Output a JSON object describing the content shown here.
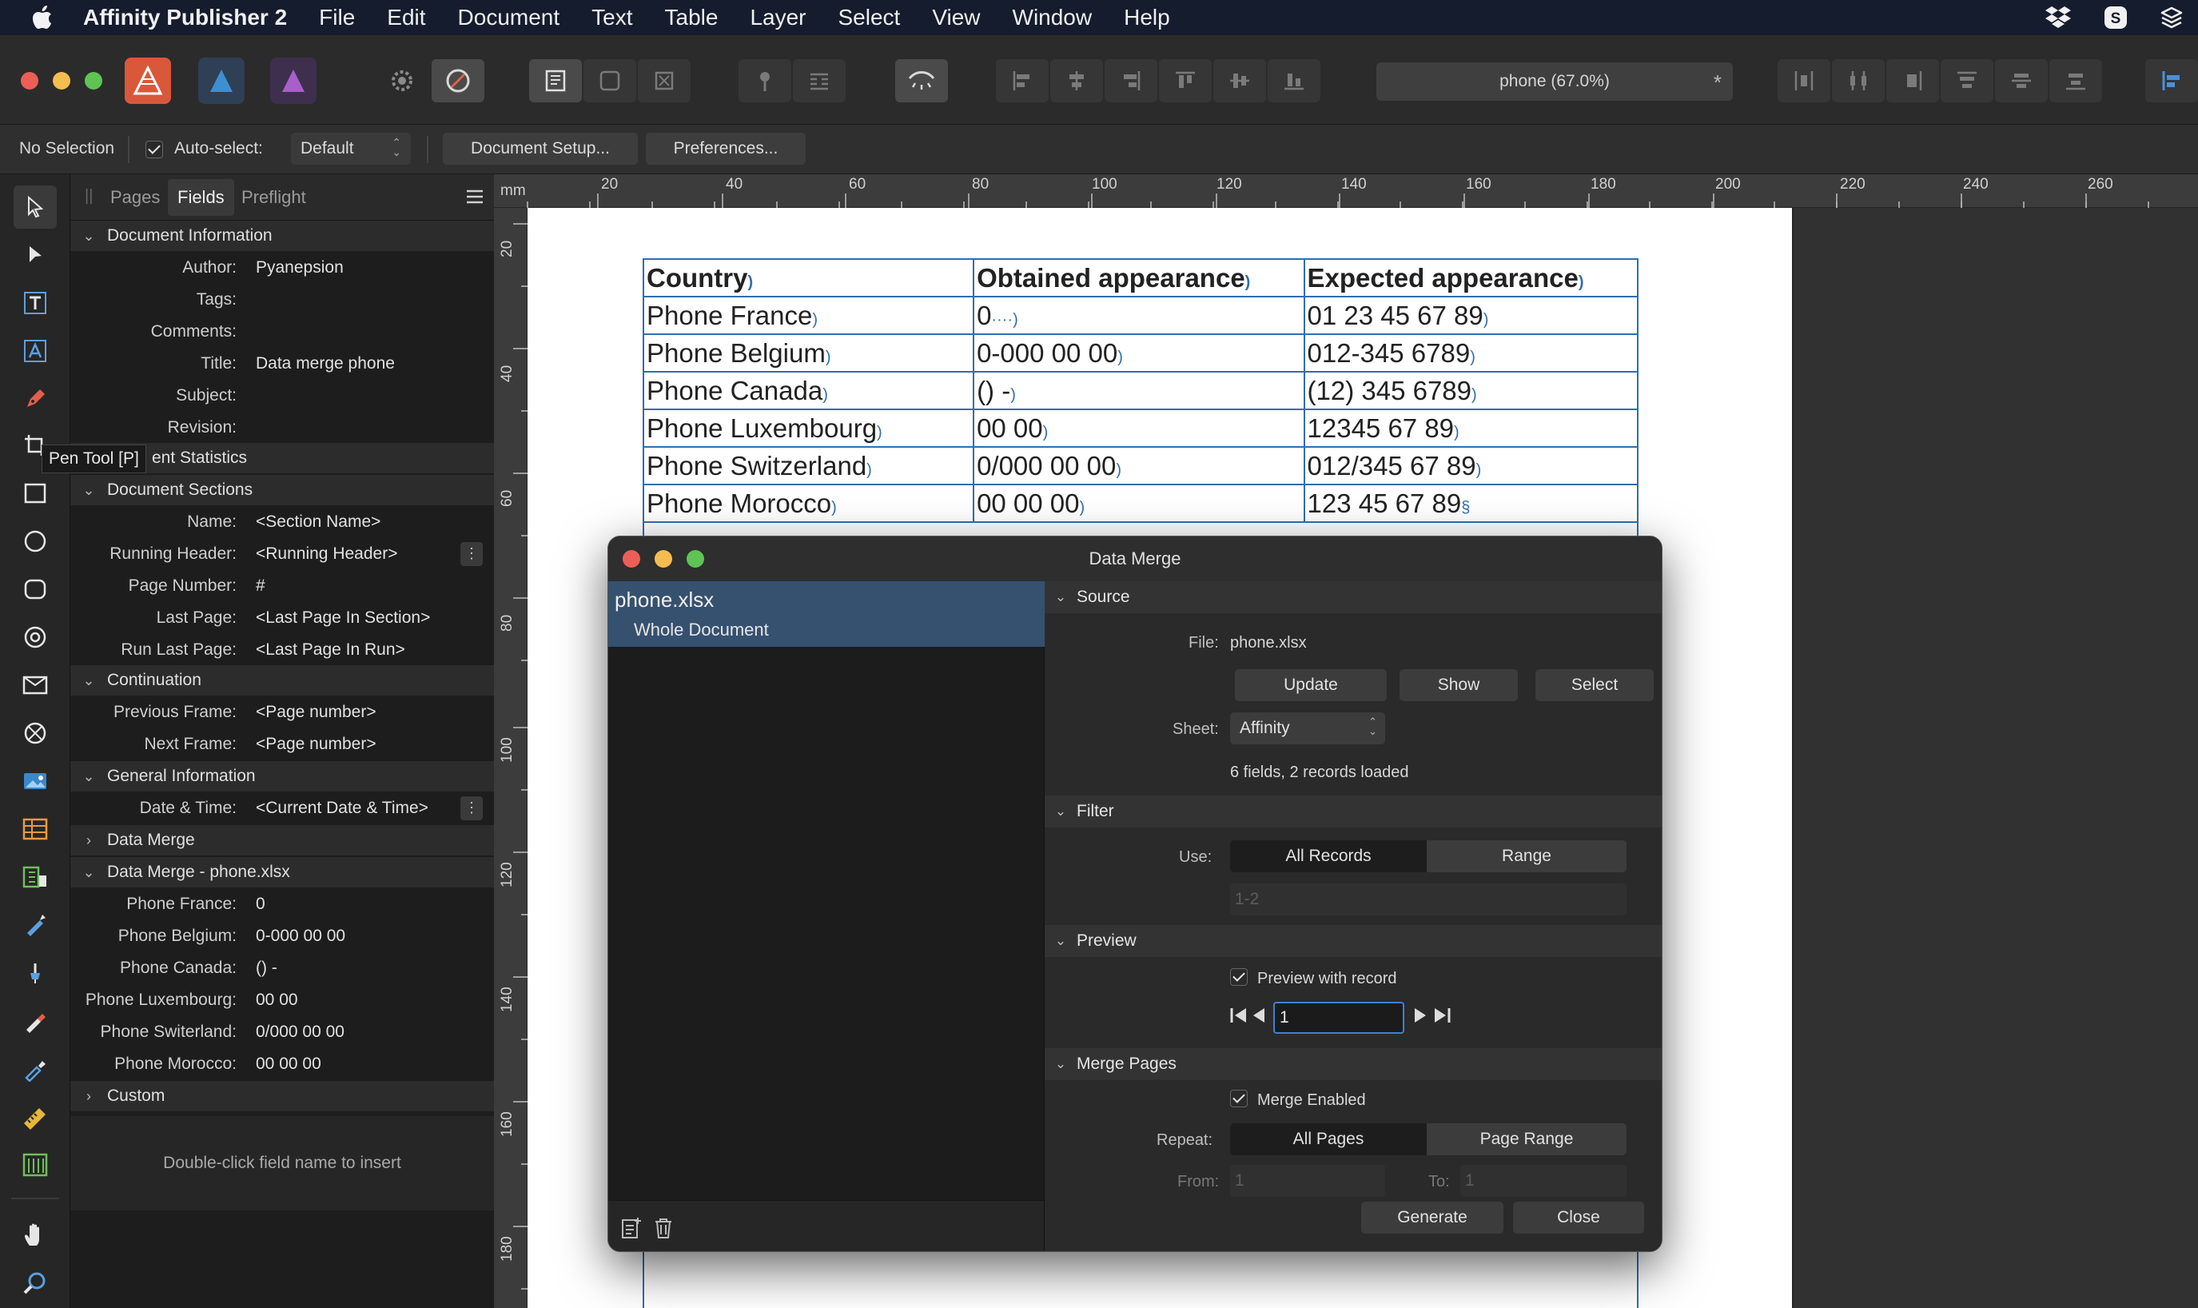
{
  "menubar": {
    "app_name": "Affinity Publisher 2",
    "items": [
      "File",
      "Edit",
      "Document",
      "Text",
      "Table",
      "Layer",
      "Select",
      "View",
      "Window",
      "Help"
    ]
  },
  "toolbar": {
    "zoom_label": "phone (67.0%)"
  },
  "context": {
    "selection": "No Selection",
    "autoselect_label": "Auto-select:",
    "autoselect_value": "Default",
    "doc_setup": "Document Setup...",
    "preferences": "Preferences..."
  },
  "tooltip": "Pen Tool [P]",
  "panel": {
    "tabs": [
      "Pages",
      "Fields",
      "Preflight"
    ],
    "doc_info": {
      "header": "Document Information",
      "rows": [
        {
          "k": "Author:",
          "v": "Pyanepsion"
        },
        {
          "k": "Tags:",
          "v": ""
        },
        {
          "k": "Comments:",
          "v": ""
        },
        {
          "k": "Title:",
          "v": "Data merge phone"
        },
        {
          "k": "Subject:",
          "v": ""
        },
        {
          "k": "Revision:",
          "v": ""
        }
      ]
    },
    "doc_stats_header": "ent Statistics",
    "sections": {
      "header": "Document Sections",
      "rows": [
        {
          "k": "Name:",
          "v": "<Section Name>"
        },
        {
          "k": "Running Header:",
          "v": "<Running Header>"
        },
        {
          "k": "Page Number:",
          "v": "#"
        },
        {
          "k": "Last Page:",
          "v": "<Last Page In Section>"
        },
        {
          "k": "Run Last Page:",
          "v": "<Last Page In Run>"
        }
      ]
    },
    "continuation": {
      "header": "Continuation",
      "rows": [
        {
          "k": "Previous Frame:",
          "v": "<Page number>"
        },
        {
          "k": "Next Frame:",
          "v": "<Page number>"
        }
      ]
    },
    "general": {
      "header": "General Information",
      "rows": [
        {
          "k": "Date & Time:",
          "v": "<Current Date & Time>"
        }
      ]
    },
    "data_merge_header": "Data Merge",
    "data_merge_file": {
      "header": "Data Merge - phone.xlsx",
      "rows": [
        {
          "k": "Phone France:",
          "v": "0"
        },
        {
          "k": "Phone Belgium:",
          "v": "0-000 00 00"
        },
        {
          "k": "Phone Canada:",
          "v": "() -"
        },
        {
          "k": "Phone Luxembourg:",
          "v": " 00 00"
        },
        {
          "k": "Phone Switerland:",
          "v": "0/000 00 00"
        },
        {
          "k": "Phone Morocco:",
          "v": " 00 00 00"
        }
      ]
    },
    "custom_header": "Custom",
    "hint": "Double-click field name to insert"
  },
  "ruler": {
    "unit": "mm",
    "h_ticks": [
      "20",
      "40",
      "60",
      "80",
      "100",
      "120",
      "140",
      "160",
      "180",
      "200",
      "220",
      "240",
      "260"
    ],
    "v_ticks": [
      "20",
      "40",
      "60",
      "80",
      "100",
      "120",
      "140",
      "160",
      "180"
    ]
  },
  "doc_table": {
    "headers": [
      "Country",
      "Obtained appearance",
      "Expected appearance"
    ],
    "rows": [
      [
        "Phone France",
        "0",
        "01 23 45 67 89"
      ],
      [
        "Phone Belgium",
        "0-000 00 00",
        "012-345 6789"
      ],
      [
        "Phone Canada",
        "() -",
        "(12) 345 6789"
      ],
      [
        "Phone Luxembourg",
        " 00 00",
        "12345 67 89"
      ],
      [
        "Phone Switzerland",
        "0/000 00 00",
        "012/345 67 89"
      ],
      [
        "Phone Morocco",
        " 00 00 00",
        "123 45 67 89"
      ]
    ]
  },
  "dialog": {
    "title": "Data Merge",
    "list_file": "phone.xlsx",
    "list_sub": "Whole Document",
    "source": {
      "header": "Source",
      "file_label": "File:",
      "file_value": "phone.xlsx",
      "update": "Update",
      "show": "Show",
      "select": "Select",
      "sheet_label": "Sheet:",
      "sheet_value": "Affinity",
      "status": "6 fields, 2 records loaded"
    },
    "filter": {
      "header": "Filter",
      "use_label": "Use:",
      "all_records": "All Records",
      "range": "Range",
      "range_placeholder": "1-2"
    },
    "preview": {
      "header": "Preview",
      "checkbox_label": "Preview with record",
      "record": "1"
    },
    "merge": {
      "header": "Merge Pages",
      "checkbox_label": "Merge Enabled",
      "repeat_label": "Repeat:",
      "all_pages": "All Pages",
      "page_range": "Page Range",
      "from_label": "From:",
      "from_value": "1",
      "to_label": "To:",
      "to_value": "1",
      "generate": "Generate",
      "close": "Close"
    }
  }
}
